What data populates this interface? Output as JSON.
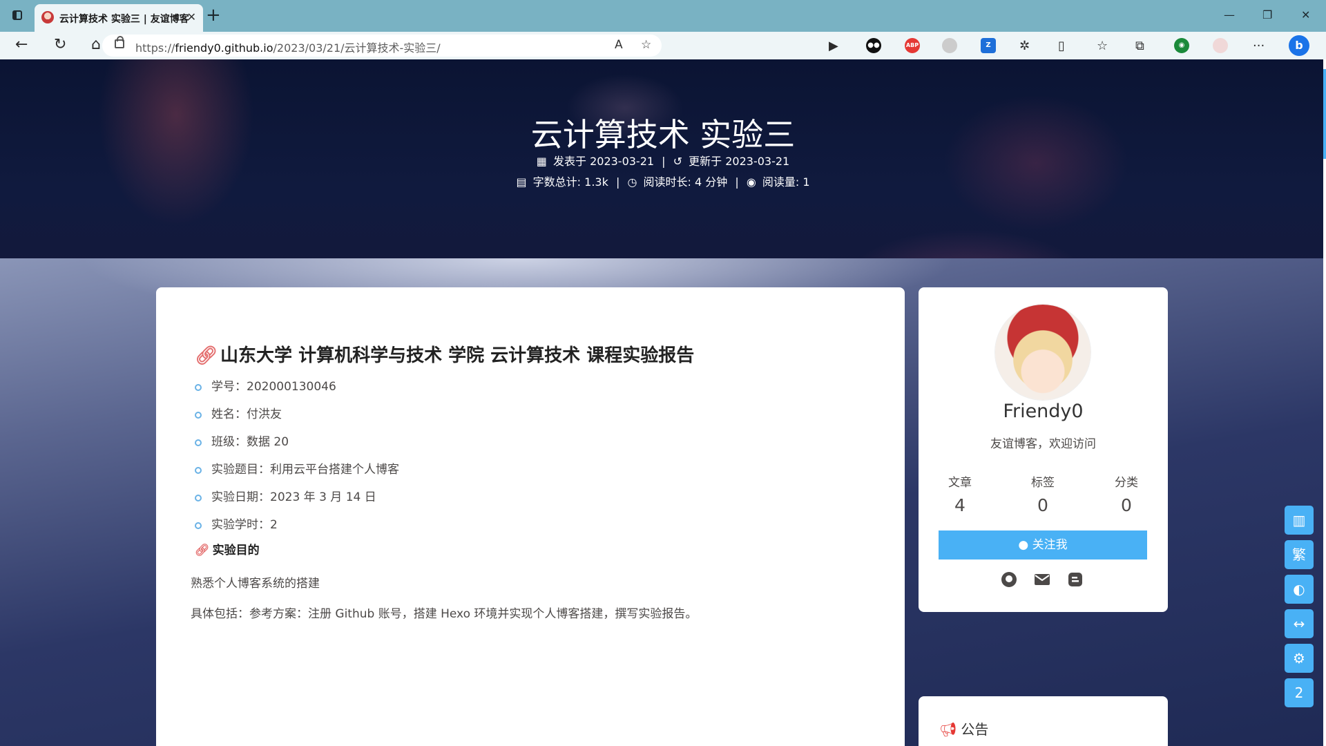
{
  "browser": {
    "tab_title": "云计算技术 实验三 | 友谊博客",
    "tab_close": "✕",
    "new_tab": "+",
    "url_prefix": "https://",
    "url_host": "friendy0.github.io",
    "url_path": "/2023/03/21/云计算技术-实验三/",
    "ext_abp": "ABP"
  },
  "hero": {
    "title": "云计算技术 实验三",
    "published_label": "发表于",
    "published_date": "2023-03-21",
    "updated_label": "更新于",
    "updated_date": "2023-03-21",
    "word_count": "字数总计: 1.3k",
    "read_time": "阅读时长: 4 分钟",
    "views": "阅读量: 1"
  },
  "post": {
    "heading": "山东大学 计算机科学与技术 学院 云计算技术 课程实验报告",
    "items": [
      "学号：202000130046",
      "姓名：付洪友",
      "班级：数据 20",
      "实验题目：利用云平台搭建个人博客",
      "实验日期：2023 年 3 月 14 日",
      "实验学时：2"
    ],
    "section_title": "实验目的",
    "para1": "熟悉个人博客系统的搭建",
    "para2": "具体包括：参考方案：注册 Github 账号，搭建 Hexo 环境并实现个人博客搭建，撰写实验报告。"
  },
  "profile": {
    "name": "Friendy0",
    "description": "友谊博客，欢迎访问",
    "stats": [
      {
        "label": "文章",
        "value": "4"
      },
      {
        "label": "标签",
        "value": "0"
      },
      {
        "label": "分类",
        "value": "0"
      }
    ],
    "follow_label": "关注我"
  },
  "notice": {
    "title": "公告"
  },
  "rightside": {
    "traditional": "繁",
    "count": "2"
  },
  "colors": {
    "accent": "#49b1f5",
    "link_icon": "#e46f6f",
    "announce": "#e53935"
  }
}
